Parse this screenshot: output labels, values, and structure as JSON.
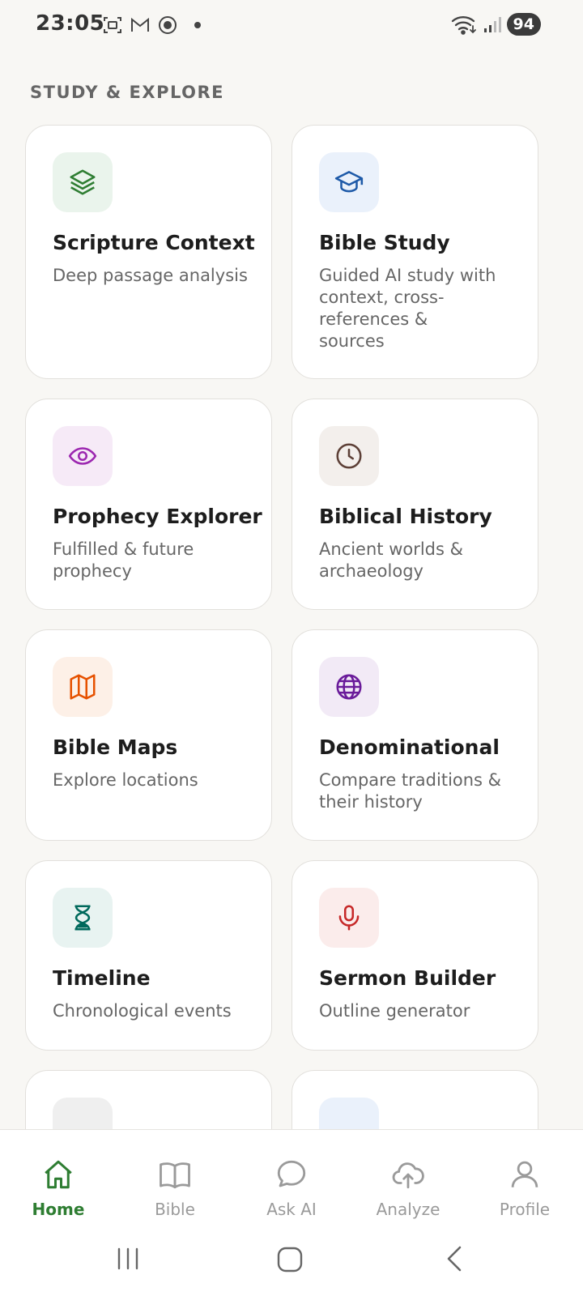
{
  "status_bar": {
    "time": "23:05",
    "battery": "94"
  },
  "section": {
    "heading": "STUDY & EXPLORE"
  },
  "cards": [
    {
      "title": "Scripture Context",
      "desc": "Deep passage analysis",
      "icon": "layers-icon",
      "tile_color": "#eaf4ec",
      "icon_color": "#2e7d32"
    },
    {
      "title": "Bible Study",
      "desc": "Guided AI study with context, cross-references & sources",
      "icon": "graduation-cap-icon",
      "tile_color": "#eaf1fb",
      "icon_color": "#1e5aa8"
    },
    {
      "title": "Prophecy Explorer",
      "desc": "Fulfilled & future prophecy",
      "icon": "eye-icon",
      "tile_color": "#f6eaf7",
      "icon_color": "#9c27b0"
    },
    {
      "title": "Biblical History",
      "desc": "Ancient worlds & archaeology",
      "icon": "clock-icon",
      "tile_color": "#f3efec",
      "icon_color": "#5d4037"
    },
    {
      "title": "Bible Maps",
      "desc": "Explore locations",
      "icon": "map-icon",
      "tile_color": "#fdf0e7",
      "icon_color": "#e65100"
    },
    {
      "title": "Denominational",
      "desc": "Compare traditions & their history",
      "icon": "globe-icon",
      "tile_color": "#f2eaf6",
      "icon_color": "#6a1b9a"
    },
    {
      "title": "Timeline",
      "desc": "Chronological events",
      "icon": "hourglass-icon",
      "tile_color": "#e8f3f1",
      "icon_color": "#00695c"
    },
    {
      "title": "Sermon Builder",
      "desc": "Outline generator",
      "icon": "microphone-icon",
      "tile_color": "#fbeceb",
      "icon_color": "#c62828"
    }
  ],
  "bottom_nav": [
    {
      "label": "Home",
      "icon": "home-icon",
      "active": true
    },
    {
      "label": "Bible",
      "icon": "book-icon",
      "active": false
    },
    {
      "label": "Ask AI",
      "icon": "chat-bubble-icon",
      "active": false
    },
    {
      "label": "Analyze",
      "icon": "upload-cloud-icon",
      "active": false
    },
    {
      "label": "Profile",
      "icon": "user-icon",
      "active": false
    }
  ],
  "colors": {
    "accent": "#2e7d32",
    "inactive": "#9a9a9a"
  }
}
